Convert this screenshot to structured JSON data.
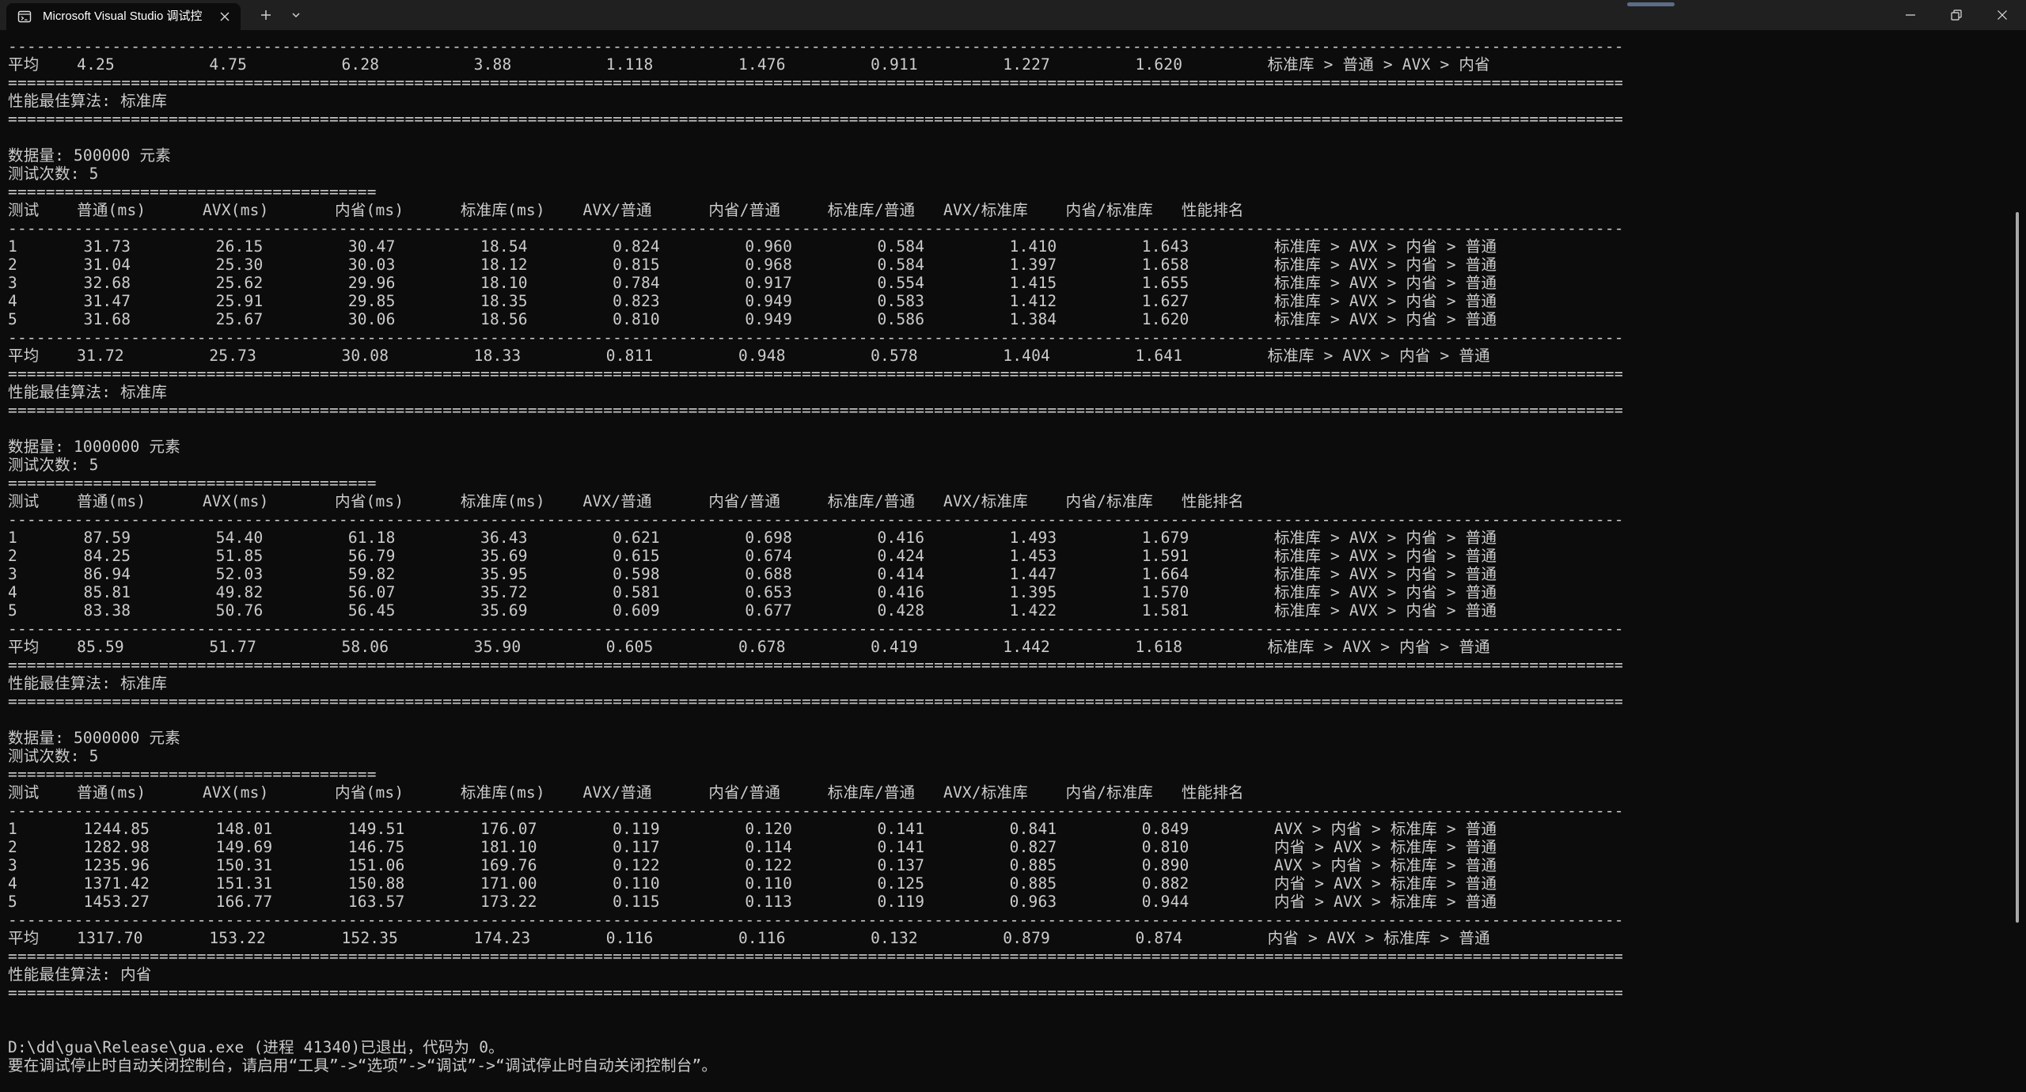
{
  "window": {
    "tab_title": "Microsoft Visual Studio 调试控",
    "icons": {
      "tab": "terminal-icon",
      "close_tab": "close-icon",
      "new_tab": "plus-icon",
      "dropdown": "chevron-down-icon",
      "minimize": "minimize-icon",
      "maximize": "restore-icon",
      "close": "close-icon"
    }
  },
  "console": {
    "lines": [
      "-----------------------------------------------------------------------------------------------------------------------------------------------------------------------------------------------------------------------",
      "平均    4.25          4.75          6.28          3.88          1.118         1.476         0.911         1.227         1.620         标准库 > 普通 > AVX > 内省",
      "=======================================================================================================================================================================================================================",
      "性能最佳算法: 标准库",
      "=======================================================================================================================================================================================================================",
      "",
      "数据量: 500000 元素",
      "测试次数: 5",
      "=======================================",
      "测试    普通(ms)      AVX(ms)       内省(ms)      标准库(ms)    AVX/普通      内省/普通     标准库/普通   AVX/标准库    内省/标准库   性能排名",
      "-----------------------------------------------------------------------------------------------------------------------------------------------------------------------------------------------------------------------",
      "1       31.73         26.15         30.47         18.54         0.824         0.960         0.584         1.410         1.643         标准库 > AVX > 内省 > 普通",
      "2       31.04         25.30         30.03         18.12         0.815         0.968         0.584         1.397         1.658         标准库 > AVX > 内省 > 普通",
      "3       32.68         25.62         29.96         18.10         0.784         0.917         0.554         1.415         1.655         标准库 > AVX > 内省 > 普通",
      "4       31.47         25.91         29.85         18.35         0.823         0.949         0.583         1.412         1.627         标准库 > AVX > 内省 > 普通",
      "5       31.68         25.67         30.06         18.56         0.810         0.949         0.586         1.384         1.620         标准库 > AVX > 内省 > 普通",
      "-----------------------------------------------------------------------------------------------------------------------------------------------------------------------------------------------------------------------",
      "平均    31.72         25.73         30.08         18.33         0.811         0.948         0.578         1.404         1.641         标准库 > AVX > 内省 > 普通",
      "=======================================================================================================================================================================================================================",
      "性能最佳算法: 标准库",
      "=======================================================================================================================================================================================================================",
      "",
      "数据量: 1000000 元素",
      "测试次数: 5",
      "=======================================",
      "测试    普通(ms)      AVX(ms)       内省(ms)      标准库(ms)    AVX/普通      内省/普通     标准库/普通   AVX/标准库    内省/标准库   性能排名",
      "-----------------------------------------------------------------------------------------------------------------------------------------------------------------------------------------------------------------------",
      "1       87.59         54.40         61.18         36.43         0.621         0.698         0.416         1.493         1.679         标准库 > AVX > 内省 > 普通",
      "2       84.25         51.85         56.79         35.69         0.615         0.674         0.424         1.453         1.591         标准库 > AVX > 内省 > 普通",
      "3       86.94         52.03         59.82         35.95         0.598         0.688         0.414         1.447         1.664         标准库 > AVX > 内省 > 普通",
      "4       85.81         49.82         56.07         35.72         0.581         0.653         0.416         1.395         1.570         标准库 > AVX > 内省 > 普通",
      "5       83.38         50.76         56.45         35.69         0.609         0.677         0.428         1.422         1.581         标准库 > AVX > 内省 > 普通",
      "-----------------------------------------------------------------------------------------------------------------------------------------------------------------------------------------------------------------------",
      "平均    85.59         51.77         58.06         35.90         0.605         0.678         0.419         1.442         1.618         标准库 > AVX > 内省 > 普通",
      "=======================================================================================================================================================================================================================",
      "性能最佳算法: 标准库",
      "=======================================================================================================================================================================================================================",
      "",
      "数据量: 5000000 元素",
      "测试次数: 5",
      "=======================================",
      "测试    普通(ms)      AVX(ms)       内省(ms)      标准库(ms)    AVX/普通      内省/普通     标准库/普通   AVX/标准库    内省/标准库   性能排名",
      "-----------------------------------------------------------------------------------------------------------------------------------------------------------------------------------------------------------------------",
      "1       1244.85       148.01        149.51        176.07        0.119         0.120         0.141         0.841         0.849         AVX > 内省 > 标准库 > 普通",
      "2       1282.98       149.69        146.75        181.10        0.117         0.114         0.141         0.827         0.810         内省 > AVX > 标准库 > 普通",
      "3       1235.96       150.31        151.06        169.76        0.122         0.122         0.137         0.885         0.890         AVX > 内省 > 标准库 > 普通",
      "4       1371.42       151.31        150.88        171.00        0.110         0.110         0.125         0.885         0.882         内省 > AVX > 标准库 > 普通",
      "5       1453.27       166.77        163.57        173.22        0.115         0.113         0.119         0.963         0.944         内省 > AVX > 标准库 > 普通",
      "-----------------------------------------------------------------------------------------------------------------------------------------------------------------------------------------------------------------------",
      "平均    1317.70       153.22        152.35        174.23        0.116         0.116         0.132         0.879         0.874         内省 > AVX > 标准库 > 普通",
      "=======================================================================================================================================================================================================================",
      "性能最佳算法: 内省",
      "=======================================================================================================================================================================================================================",
      "",
      "",
      "D:\\dd\\gua\\Release\\gua.exe (进程 41340)已退出，代码为 0。",
      "要在调试停止时自动关闭控制台，请启用“工具”->“选项”->“调试”->“调试停止时自动关闭控制台”。"
    ]
  },
  "colors": {
    "background": "#0c0c0c",
    "titlebar": "#202020",
    "text": "#cccccc"
  }
}
